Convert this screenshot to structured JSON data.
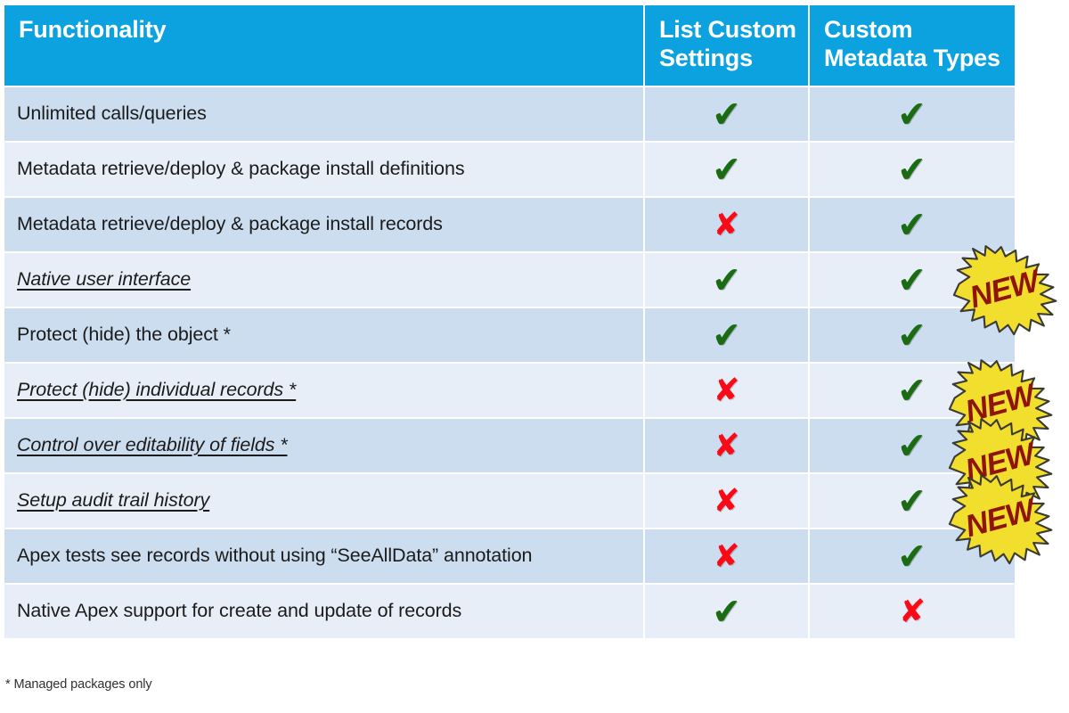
{
  "table": {
    "columns": [
      {
        "id": "functionality",
        "label": "Functionality"
      },
      {
        "id": "list_custom_settings",
        "label": "List Custom Settings"
      },
      {
        "id": "custom_metadata_types",
        "label": "Custom Metadata Types"
      }
    ],
    "header_colors": {
      "background": "#0CA2DF",
      "text": "#FFFFFF"
    },
    "row_colors": {
      "odd": "#CADCEF",
      "even": "#E7EEF8"
    },
    "mark_colors": {
      "check": "#1A6B12",
      "cross": "#FA0A17"
    },
    "rows": [
      {
        "label": "Unlimited calls/queries",
        "emphasis": false,
        "list_custom_settings": "check",
        "custom_metadata_types": "check",
        "badge": null
      },
      {
        "label": "Metadata retrieve/deploy & package install definitions",
        "emphasis": false,
        "list_custom_settings": "check",
        "custom_metadata_types": "check",
        "badge": null
      },
      {
        "label": "Metadata retrieve/deploy & package install records",
        "emphasis": false,
        "list_custom_settings": "cross",
        "custom_metadata_types": "check",
        "badge": null
      },
      {
        "label": "Native user interface",
        "emphasis": true,
        "list_custom_settings": "check",
        "custom_metadata_types": "check",
        "badge": "NEW"
      },
      {
        "label": "Protect (hide) the object *",
        "emphasis": false,
        "list_custom_settings": "check",
        "custom_metadata_types": "check",
        "badge": null
      },
      {
        "label": "Protect (hide) individual records *",
        "emphasis": true,
        "list_custom_settings": "cross",
        "custom_metadata_types": "check",
        "badge": "NEW"
      },
      {
        "label": "Control over editability of fields *",
        "emphasis": true,
        "list_custom_settings": "cross",
        "custom_metadata_types": "check",
        "badge": "NEW"
      },
      {
        "label": "Setup audit trail history",
        "emphasis": true,
        "list_custom_settings": "cross",
        "custom_metadata_types": "check",
        "badge": "NEW"
      },
      {
        "label": "Apex tests see records without using “SeeAllData” annotation",
        "emphasis": false,
        "list_custom_settings": "cross",
        "custom_metadata_types": "check",
        "badge": null
      },
      {
        "label": "Native Apex support for create and update of records",
        "emphasis": false,
        "list_custom_settings": "check",
        "custom_metadata_types": "cross",
        "badge": null
      }
    ]
  },
  "badges": {
    "new_label": "NEW",
    "fill": "#F2DE2C",
    "text_color": "#8E1408",
    "items": [
      {
        "id": "burst-1",
        "label": "NEW",
        "row": "Native user interface"
      },
      {
        "id": "burst-2",
        "label": "NEW",
        "row": "Protect (hide) individual records *"
      },
      {
        "id": "burst-3",
        "label": "NEW",
        "row": "Control over editability of fields *"
      },
      {
        "id": "burst-4",
        "label": "NEW",
        "row": "Setup audit trail history"
      }
    ]
  },
  "glyphs": {
    "check": "✔",
    "cross": "✘"
  },
  "footnote": "* Managed packages only"
}
